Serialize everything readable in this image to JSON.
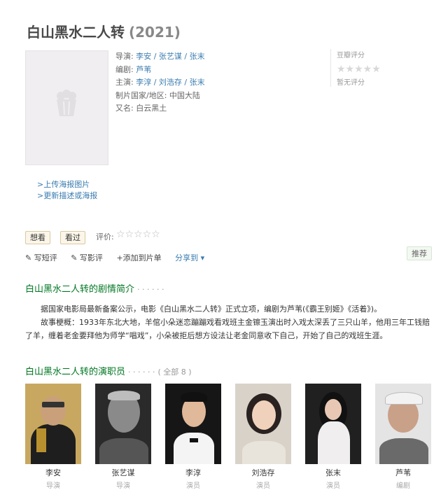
{
  "movie": {
    "title": "白山黑水二人转",
    "year": "(2021)"
  },
  "info": {
    "director_label": "导演:",
    "director_value": "李安 / 张艺谋 / 张末",
    "writer_label": "编剧:",
    "writer_value": "芦苇",
    "cast_label": "主演:",
    "cast_value": "李淳 / 刘浩存 / 张末",
    "country_label": "制片国家/地区:",
    "country_value": "中国大陆",
    "aka_label": "又名:",
    "aka_value": "白云黑土"
  },
  "rating": {
    "label": "豆瓣评分",
    "stars": "★★★★★",
    "none_text": "暂无评分"
  },
  "poster_links": {
    "upload": ">上传海报图片",
    "update": ">更新描述或海报"
  },
  "buttons": {
    "want": "想看",
    "seen": "看过",
    "rate_label": "评价:",
    "rate_stars": "☆☆☆☆☆"
  },
  "actions": {
    "short_review": "✎ 写短评",
    "review": "✎ 写影评",
    "add_list": "+添加到片单",
    "share": "分享到 ▾"
  },
  "recommend": "推荐",
  "summary": {
    "heading": "白山黑水二人转的剧情简介",
    "dots": "· · · · · ·",
    "p1": "据国家电影局最新备案公示，电影《白山黑水二人转》正式立项，编剧为芦苇(《霸王别姬》《活着》)。",
    "p2": "故事梗概：1933年东北大地，羊倌小朵迷恋蹦蹦戏看戏班主金镲玉演出时入戏太深丢了三只山羊，他用三年工钱赔了羊，缠着老金要拜他为师学“唱戏”，小朵被拒后想方设法让老金同意收下自己，开始了自己的戏班生涯。"
  },
  "cast_section": {
    "heading": "白山黑水二人转的演职员",
    "dots": "· · · · · ·",
    "count": "( 全部 8 )"
  },
  "cast": [
    {
      "name": "李安",
      "role": "导演"
    },
    {
      "name": "张艺谋",
      "role": "导演"
    },
    {
      "name": "李淳",
      "role": "演员"
    },
    {
      "name": "刘浩存",
      "role": "演员"
    },
    {
      "name": "张末",
      "role": "演员"
    },
    {
      "name": "芦苇",
      "role": "编剧"
    }
  ],
  "colors": {
    "link": "#3a7cb0",
    "section": "#007722",
    "button_bg": "#fbf6e9"
  },
  "icons": {
    "poster_placeholder": "popcorn-icon",
    "pen": "pen-icon"
  }
}
